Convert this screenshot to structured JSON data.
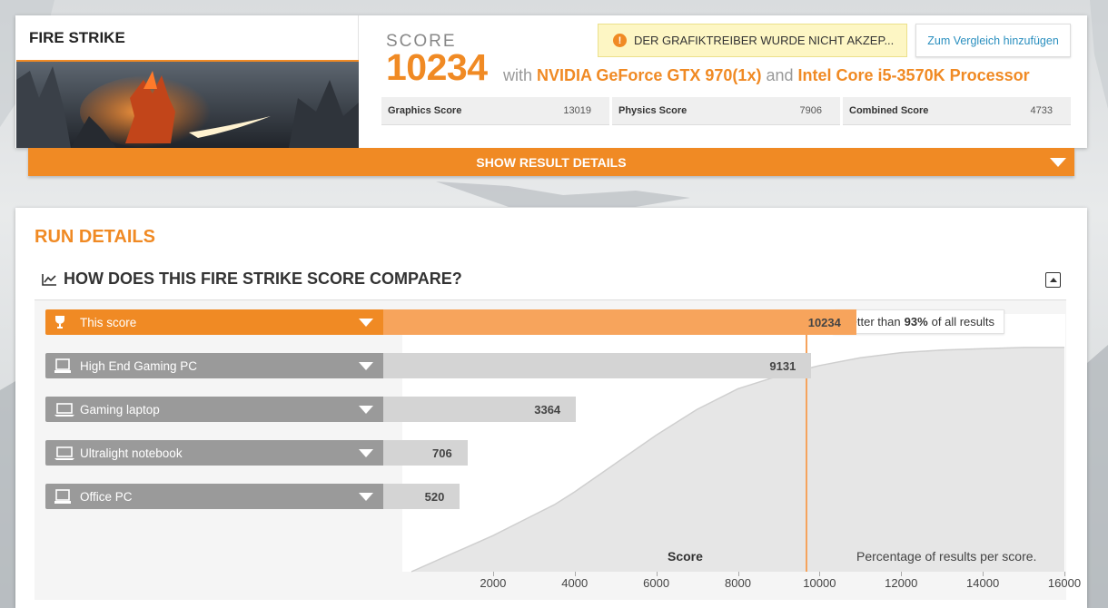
{
  "test": {
    "name": "FIRE STRIKE"
  },
  "score": {
    "label": "SCORE",
    "value": "10234",
    "with_word": "with",
    "gpu": "NVIDIA GeForce GTX 970(1x)",
    "and_word": "and",
    "cpu": "Intel Core i5-3570K Processor"
  },
  "warning": {
    "text": "DER GRAFIKTREIBER WURDE NICHT AKZEP..."
  },
  "compare_button": {
    "label": "Zum Vergleich hinzufügen"
  },
  "subscores": [
    {
      "name": "Graphics Score",
      "value": "13019"
    },
    {
      "name": "Physics Score",
      "value": "7906"
    },
    {
      "name": "Combined Score",
      "value": "4733"
    }
  ],
  "show_details": {
    "label": "SHOW RESULT DETAILS"
  },
  "run_details": {
    "title": "RUN DETAILS",
    "compare_title": "HOW DOES THIS FIRE STRIKE SCORE COMPARE?"
  },
  "comparison": {
    "tooltip_prefix": "Better than",
    "tooltip_percent": "93%",
    "tooltip_suffix": "of all results",
    "axis_title": "Score",
    "axis_note": "Percentage of results per score.",
    "rows": [
      {
        "label": "This score",
        "value": "10234",
        "icon": "trophy-icon"
      },
      {
        "label": "High End Gaming PC",
        "value": "9131",
        "icon": "desktop-icon"
      },
      {
        "label": "Gaming laptop",
        "value": "3364",
        "icon": "laptop-icon"
      },
      {
        "label": "Ultralight notebook",
        "value": "706",
        "icon": "laptop-icon"
      },
      {
        "label": "Office PC",
        "value": "520",
        "icon": "desktop-icon"
      }
    ]
  },
  "chart_data": {
    "type": "area",
    "xlabel": "Score",
    "ylabel": "",
    "x_ticks": [
      "2000",
      "4000",
      "6000",
      "8000",
      "10000",
      "12000",
      "14000",
      "16000"
    ],
    "xlim": [
      0,
      16000
    ],
    "percentile_of_this_score": 93,
    "marker_x": 10234,
    "bars": [
      {
        "name": "This score",
        "value": 10234
      },
      {
        "name": "High End Gaming PC",
        "value": 9131
      },
      {
        "name": "Gaming laptop",
        "value": 3364
      },
      {
        "name": "Ultralight notebook",
        "value": 706
      },
      {
        "name": "Office PC",
        "value": 520
      }
    ],
    "curve": {
      "x": [
        0,
        1000,
        2000,
        3000,
        3500,
        4000,
        5000,
        6000,
        7000,
        8000,
        9000,
        10000,
        11000,
        12000,
        13000,
        14000,
        15000,
        16000
      ],
      "y_percent": [
        0,
        7,
        14,
        22,
        26,
        31,
        42,
        53,
        63,
        71,
        76,
        80,
        83,
        85,
        86,
        86.5,
        87,
        87
      ]
    }
  }
}
